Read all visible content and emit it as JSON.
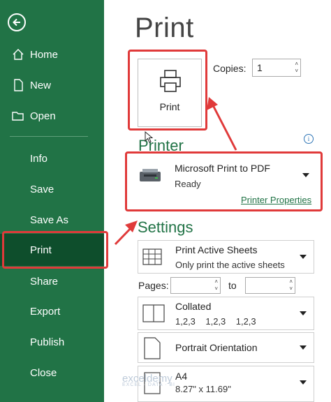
{
  "sidebar": {
    "items": [
      {
        "label": "Home"
      },
      {
        "label": "New"
      },
      {
        "label": "Open"
      },
      {
        "label": "Info"
      },
      {
        "label": "Save"
      },
      {
        "label": "Save As"
      },
      {
        "label": "Print"
      },
      {
        "label": "Share"
      },
      {
        "label": "Export"
      },
      {
        "label": "Publish"
      },
      {
        "label": "Close"
      }
    ],
    "active_item": "Print"
  },
  "main": {
    "title": "Print",
    "print_button_label": "Print",
    "copies": {
      "label": "Copies:",
      "value": "1"
    },
    "printer": {
      "heading": "Printer",
      "name": "Microsoft Print to PDF",
      "status": "Ready",
      "properties_link": "Printer Properties"
    },
    "settings": {
      "heading": "Settings",
      "print_what": {
        "title": "Print Active Sheets",
        "subtitle": "Only print the active sheets"
      },
      "pages_label": "Pages:",
      "to_label": "to",
      "collation": {
        "title": "Collated",
        "subtitle": "1,2,3    1,2,3    1,2,3"
      },
      "orientation": {
        "title": "Portrait Orientation"
      },
      "paper": {
        "title": "A4",
        "subtitle": "8.27\" x 11.69\""
      }
    }
  },
  "watermark": {
    "name": "exceldemy",
    "tagline": "EXCEL · DATA · BI"
  },
  "colors": {
    "sidebar": "#217346",
    "active": "#0e4e2c",
    "highlight": "#e03a3a",
    "accent": "#217346"
  }
}
